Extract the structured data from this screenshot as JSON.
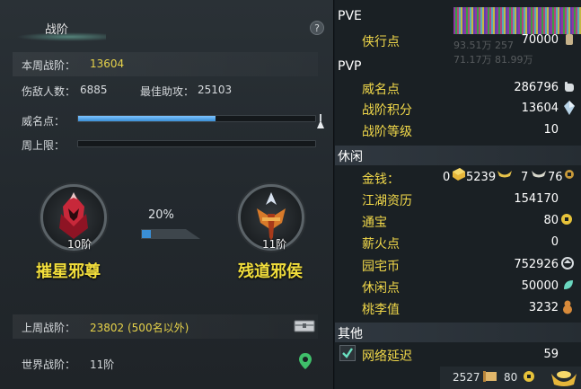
{
  "left_panel": {
    "title": "战阶",
    "help_icon": "?",
    "week_rank_label": "本周战阶：",
    "week_rank_value": "13604",
    "kills_label": "伤敌人数：",
    "kills_value": "6885",
    "assist_label": "最佳助攻：",
    "assist_value": "25103",
    "prestige_label": "威名点：",
    "prestige_progress": 0.58,
    "weekly_cap_label": "周上限：",
    "weekly_cap_progress": 0,
    "current_rank": {
      "level": "10阶",
      "name": "摧星邪尊",
      "color": "#c8283a"
    },
    "next_rank": {
      "level": "11阶",
      "name": "残道邪侯",
      "color": "#d87a2a"
    },
    "progress_percent": "20%",
    "progress_fraction": 0.2,
    "last_week_label": "上周战阶：",
    "last_week_value": "23802 (500名以外)",
    "world_label": "世界战阶：",
    "world_value": "11阶"
  },
  "right_panel": {
    "pve": {
      "header": "PVE",
      "items": [
        {
          "label": "侠行点",
          "value": "70000",
          "icon": "token-icon"
        }
      ]
    },
    "pvp": {
      "header": "PVP",
      "items": [
        {
          "label": "威名点",
          "value": "286796",
          "icon": "fist-icon"
        },
        {
          "label": "战阶积分",
          "value": "13604",
          "icon": "crystal-icon"
        },
        {
          "label": "战阶等级",
          "value": "10",
          "icon": ""
        }
      ]
    },
    "leisure": {
      "header": "休闲",
      "money_label": "金钱：",
      "money_gold": "0",
      "money_silver": "5239",
      "money_copper1": "7",
      "money_copper2": "76",
      "items": [
        {
          "label": "江湖资历",
          "value": "154170",
          "icon": ""
        },
        {
          "label": "通宝",
          "value": "80",
          "icon": "coin-icon"
        },
        {
          "label": "薪火点",
          "value": "0",
          "icon": ""
        },
        {
          "label": "园宅币",
          "value": "752926",
          "icon": "house-coin-icon"
        },
        {
          "label": "休闲点",
          "value": "50000",
          "icon": "leaf-icon"
        },
        {
          "label": "桃李值",
          "value": "3232",
          "icon": "gourd-icon"
        }
      ]
    },
    "other": {
      "header": "其他",
      "latency_label": "网络延迟",
      "latency_value": "59",
      "latency_checked": true
    },
    "bottom_bar": {
      "value_a": "2527",
      "value_b": "80"
    }
  },
  "colors": {
    "accent_yellow": "#f2d94a",
    "progress_blue": "#3a8fd6",
    "panel_bg": "#23292e"
  }
}
